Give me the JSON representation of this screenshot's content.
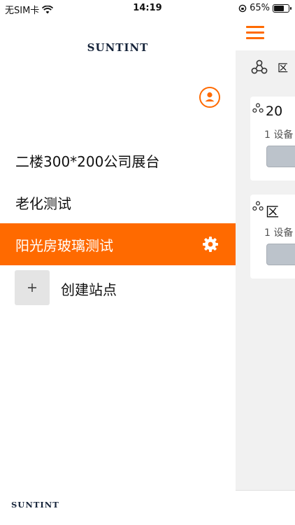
{
  "status_bar": {
    "carrier": "无SIM卡",
    "time": "14:19",
    "battery_percent": "65%",
    "battery_level": 0.65
  },
  "colors": {
    "accent": "#ff6a00",
    "logo": "#16243a",
    "panel_bg": "#f1f1f1"
  },
  "brand": {
    "logo_text": "SUNTINT"
  },
  "drawer": {
    "sites": [
      {
        "label": "二楼300*200公司展台",
        "active": false
      },
      {
        "label": "老化测试",
        "active": false
      },
      {
        "label": "阳光房玻璃测试",
        "active": true
      }
    ],
    "create_label": "创建站点"
  },
  "background_panel": {
    "zone_label": "区",
    "cards": [
      {
        "title": "20",
        "subtitle": "1 设备"
      },
      {
        "title": "区",
        "subtitle": "1 设备"
      }
    ]
  },
  "icons": {
    "menu": "hamburger-menu-icon",
    "user": "user-icon",
    "settings": "gear-icon",
    "add": "plus-icon",
    "zone": "zone-cluster-icon"
  }
}
